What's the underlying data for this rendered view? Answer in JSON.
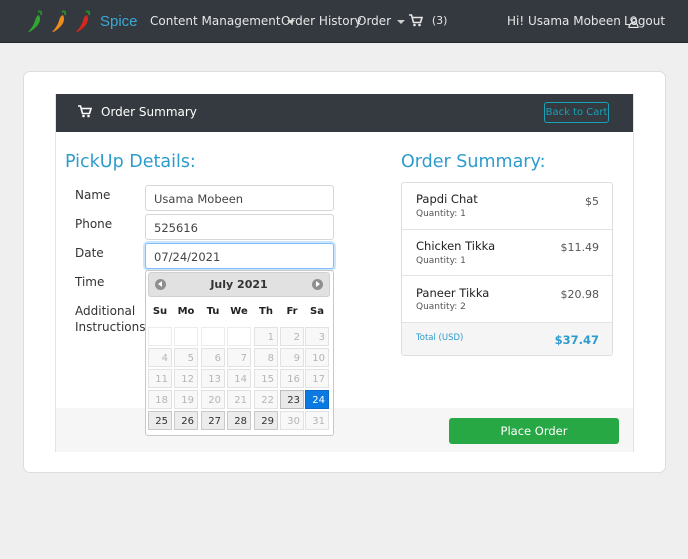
{
  "navbar": {
    "brand": "Spice",
    "content_management": "Content Management",
    "order_history": "Order History",
    "order": "Order",
    "cart_count": "(3)",
    "greeting": "Hi! Usama Mobeen",
    "logout": "Logout"
  },
  "header": {
    "title": "Order Summary",
    "back_button": "Back to Cart"
  },
  "pickup": {
    "heading": "PickUp Details:",
    "name_label": "Name",
    "name_value": "Usama Mobeen",
    "phone_label": "Phone",
    "phone_value": "525616",
    "date_label": "Date",
    "date_value": "07/24/2021",
    "time_label": "Time",
    "instructions_label_1": "Additional",
    "instructions_label_2": "Instructions:"
  },
  "datepicker": {
    "month_title": "July 2021",
    "weekdays": [
      "Su",
      "Mo",
      "Tu",
      "We",
      "Th",
      "Fr",
      "Sa"
    ],
    "weeks": [
      [
        "",
        "",
        "",
        "",
        "1",
        "2",
        "3"
      ],
      [
        "4",
        "5",
        "6",
        "7",
        "8",
        "9",
        "10"
      ],
      [
        "11",
        "12",
        "13",
        "14",
        "15",
        "16",
        "17"
      ],
      [
        "18",
        "19",
        "20",
        "21",
        "22",
        "23",
        "24"
      ],
      [
        "25",
        "26",
        "27",
        "28",
        "29",
        "30",
        "31"
      ]
    ],
    "enabled_days": [
      "23",
      "24",
      "25",
      "26",
      "27",
      "28",
      "29"
    ],
    "today": "23",
    "selected": "24"
  },
  "summary": {
    "heading": "Order Summary:",
    "items": [
      {
        "name": "Papdi Chat",
        "qty": "Quantity: 1",
        "price": "$5"
      },
      {
        "name": "Chicken Tikka",
        "qty": "Quantity: 1",
        "price": "$11.49"
      },
      {
        "name": "Paneer Tikka",
        "qty": "Quantity: 2",
        "price": "$20.98"
      }
    ],
    "total_label": "Total (USD)",
    "total_value": "$37.47"
  },
  "actions": {
    "place_order": "Place Order"
  },
  "colors": {
    "navbar_bg": "#34393f",
    "accent_blue": "#2d9ccd",
    "success_green": "#28a745",
    "selected_day": "#0a7ae2"
  }
}
